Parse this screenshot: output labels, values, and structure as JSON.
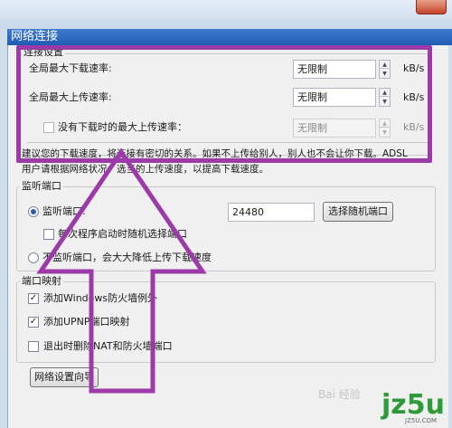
{
  "window": {
    "title": "网络连接"
  },
  "connection_settings": {
    "legend": "连接设置",
    "max_download": {
      "label": "全局最大下载速率:",
      "value": "无限制",
      "unit": "kB/s"
    },
    "max_upload": {
      "label": "全局最大上传速率:",
      "value": "无限制",
      "unit": "kB/s"
    },
    "no_download_upload": {
      "label": "没有下载时的最大上传速率：",
      "value": "无限制",
      "unit": "kB/s",
      "checked": false,
      "enabled": false
    },
    "note_line1": "建议您的下载速度，将连接有密切的关系。如果不上传给别人，别人也不会让你下载。ADSL",
    "note_line2": "用户请根据网络状况，选当的上传速度，以提高下载速度。"
  },
  "listen_port": {
    "legend": "监听端口",
    "listen_radio": {
      "label": "监听端口:",
      "selected": true
    },
    "port_value": "24480",
    "random_port_button": "选择随机端口",
    "random_on_start": {
      "label": "每次程序启动时随机选择端口",
      "checked": false
    },
    "no_listen_radio": {
      "label": "不监听端口，会大大降低上传下载速度",
      "selected": false
    }
  },
  "port_mapping": {
    "legend": "端口映射",
    "windows_firewall": {
      "label": "添加Windows防火墙例外",
      "checked": true
    },
    "upnp": {
      "label": "添加UPNP端口映射",
      "checked": true
    },
    "remove_on_exit": {
      "label": "退出时删除NAT和防火墙端口",
      "checked": false
    }
  },
  "wizard_button": "网络设置向导",
  "watermark": {
    "baidu": "Bai 经验",
    "site_logo": "jz5u",
    "site_url": "JZ5U.COM"
  },
  "colors": {
    "highlight": "#9b3aa8",
    "titlebar": "#1f5cb3",
    "logo": "#2f9a3a"
  },
  "icons": {
    "close": "close-icon",
    "spin_up": "triangle-up-icon",
    "spin_down": "triangle-down-icon",
    "check": "check-icon"
  }
}
